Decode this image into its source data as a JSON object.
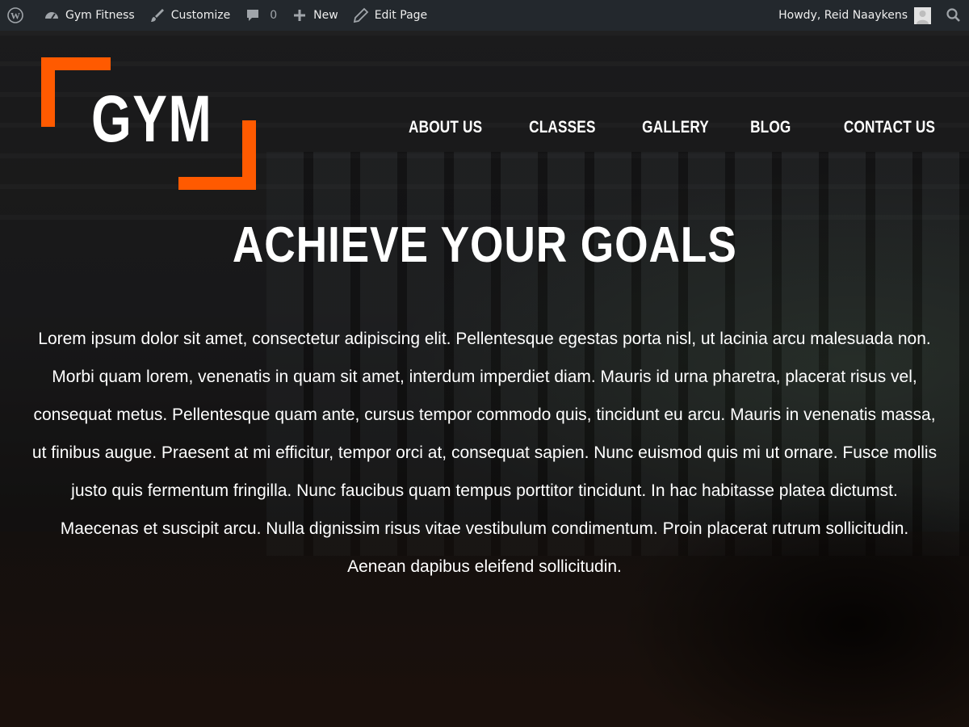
{
  "admin_bar": {
    "site_name": "Gym Fitness",
    "customize_label": "Customize",
    "comments_count": "0",
    "new_label": "New",
    "edit_label": "Edit Page",
    "greeting": "Howdy, Reid Naaykens",
    "icons": [
      "wordpress-logo-icon",
      "dashboard-icon",
      "paintbrush-icon",
      "comment-icon",
      "plus-icon",
      "pencil-icon",
      "search-icon"
    ]
  },
  "logo": {
    "text": "GYM"
  },
  "nav": {
    "items": [
      "About Us",
      "Classes",
      "Gallery",
      "Blog",
      "Contact Us"
    ]
  },
  "hero": {
    "headline": "Achieve Your Goals",
    "body": "Lorem ipsum dolor sit amet, consectetur adipiscing elit. Pellentesque egestas porta nisl, ut lacinia arcu malesuada non. Morbi quam lorem, venenatis in quam sit amet, interdum imperdiet diam. Mauris id urna pharetra, placerat risus vel, consequat metus. Pellentesque quam ante, cursus tempor commodo quis, tincidunt eu arcu. Mauris in venenatis massa, ut finibus augue. Praesent at mi efficitur, tempor orci at, consequat sapien. Nunc euismod quis mi ut ornare. Fusce mollis justo quis fermentum fringilla. Nunc faucibus quam tempus porttitor tincidunt. In hac habitasse platea dictumst. Maecenas et suscipit arcu. Nulla dignissim risus vitae vestibulum condimentum. Proin placerat rutrum sollicitudin. Aenean dapibus eleifend sollicitudin."
  },
  "colors": {
    "accent": "#ff5a00",
    "admin_bar": "#23282d",
    "text": "#ffffff"
  }
}
